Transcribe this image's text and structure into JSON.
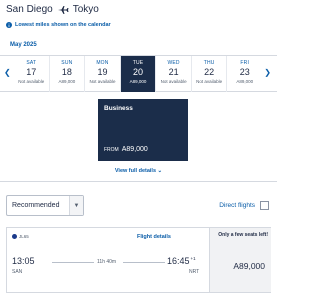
{
  "route": {
    "origin": "San Diego",
    "destination": "Tokyo"
  },
  "notice": "Lowest miles shown on the calendar",
  "month": "May 2025",
  "days": [
    {
      "dow": "SAT",
      "num": "17",
      "price": "Not available"
    },
    {
      "dow": "SUN",
      "num": "18",
      "price": "A89,000"
    },
    {
      "dow": "MON",
      "num": "19",
      "price": "Not available"
    },
    {
      "dow": "TUE",
      "num": "20",
      "price": "A89,000"
    },
    {
      "dow": "WED",
      "num": "21",
      "price": "Not available"
    },
    {
      "dow": "THU",
      "num": "22",
      "price": "Not available"
    },
    {
      "dow": "FRI",
      "num": "23",
      "price": "A89,000"
    }
  ],
  "cabin": {
    "name": "Business",
    "from_label": "FROM",
    "price": "A89,000"
  },
  "view_full_details": "View full details",
  "sort": {
    "value": "Recommended"
  },
  "direct_flights": "Direct flights",
  "flight": {
    "airline_code": "JL65",
    "details_label": "Flight details",
    "depart_time": "13:05",
    "arrive_time": "16:45",
    "arrive_offset": "+1",
    "duration": "11h 40m",
    "depart_code": "SAN",
    "arrive_code": "NRT",
    "seats_note": "Only a few seats left!",
    "fare": "A89,000"
  },
  "colors": {
    "navy": "#1b2d4a",
    "link": "#0a5da8"
  }
}
